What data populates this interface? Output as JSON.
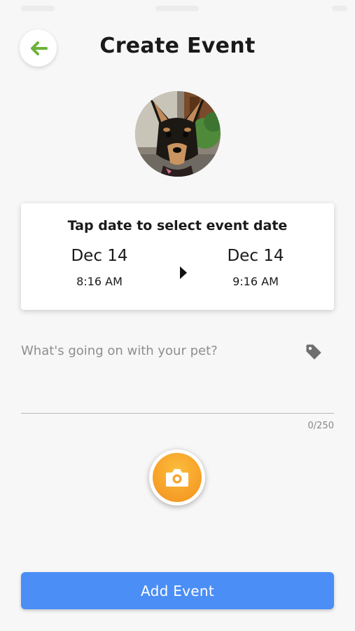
{
  "header": {
    "title": "Create Event",
    "back_icon": "arrow-left-icon",
    "accent_color": "#6bb33a"
  },
  "avatar": {
    "description": "dog-photo"
  },
  "date_card": {
    "hint": "Tap date to select event date",
    "start": {
      "date": "Dec 14",
      "time": "8:16 AM"
    },
    "end": {
      "date": "Dec 14",
      "time": "9:16 AM"
    },
    "separator_icon": "triangle-right-icon"
  },
  "description": {
    "placeholder": "What's going on with your pet?",
    "value": "",
    "tag_icon": "tag-icon",
    "counter": "0/250"
  },
  "camera": {
    "icon": "camera-icon",
    "color": "#f7a42b"
  },
  "submit": {
    "label": "Add Event",
    "color": "#4a8ef6"
  }
}
